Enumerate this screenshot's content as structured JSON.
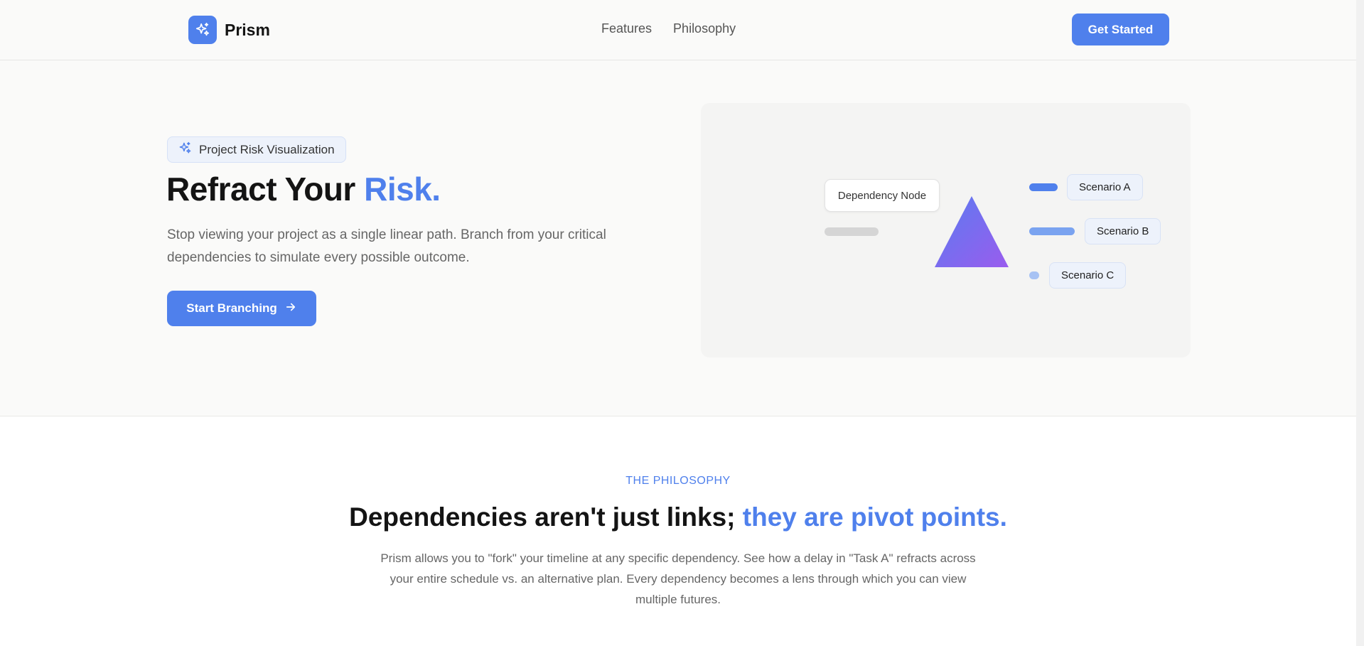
{
  "brand": {
    "name": "Prism",
    "color": "#4f80ec"
  },
  "nav": {
    "items": [
      {
        "label": "Features"
      },
      {
        "label": "Philosophy"
      }
    ],
    "cta": "Get Started"
  },
  "hero": {
    "badge": "Project Risk Visualization",
    "title_main": "Refract Your ",
    "title_accent": "Risk.",
    "subtitle": "Stop viewing your project as a single linear path. Branch from your critical dependencies to simulate every possible outcome.",
    "cta": "Start Branching"
  },
  "illustration": {
    "node_label": "Dependency Node",
    "scenarios": [
      {
        "label": "Scenario A"
      },
      {
        "label": "Scenario B"
      },
      {
        "label": "Scenario C"
      }
    ]
  },
  "philosophy": {
    "eyebrow": "THE PHILOSOPHY",
    "title_main": "Dependencies aren't just links; ",
    "title_accent": "they are pivot points.",
    "body": "Prism allows you to \"fork\" your timeline at any specific dependency. See how a delay in \"Task A\" refracts across your entire schedule vs. an alternative plan. Every dependency becomes a lens through which you can view multiple futures."
  }
}
